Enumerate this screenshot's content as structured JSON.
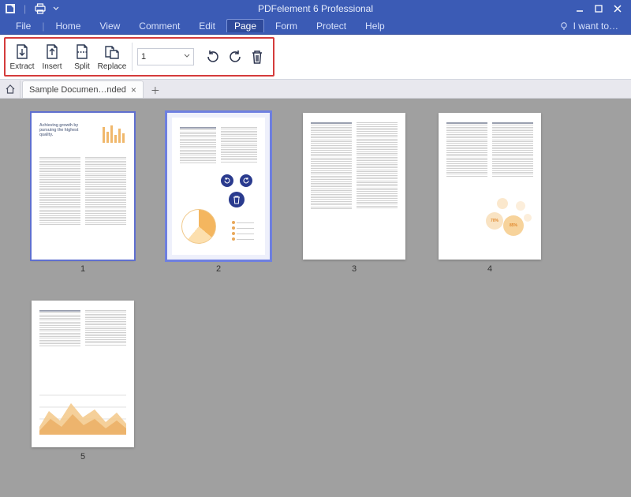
{
  "app": {
    "title": "PDFelement 6 Professional"
  },
  "menu": {
    "items": [
      "File",
      "Home",
      "View",
      "Comment",
      "Edit",
      "Page",
      "Form",
      "Protect",
      "Help"
    ],
    "active": "Page",
    "iwant": "I want to…"
  },
  "toolbar": {
    "extract": "Extract",
    "insert": "Insert",
    "split": "Split",
    "replace": "Replace",
    "page_value": "1"
  },
  "tabs": {
    "doc": "Sample Documen…nded"
  },
  "thumbs": {
    "labels": [
      "1",
      "2",
      "3",
      "4",
      "5"
    ],
    "page1_heading": "Achieving growth by pursuing the highest quality.",
    "bubble_a": "70%",
    "bubble_b": "85%"
  }
}
